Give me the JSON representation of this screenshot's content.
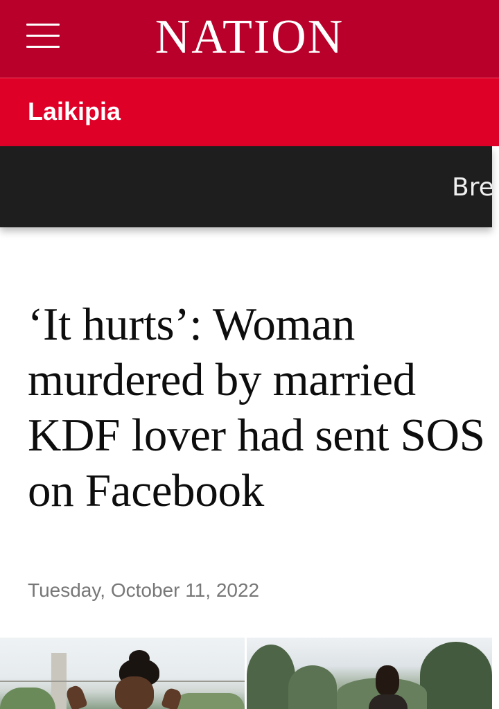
{
  "header": {
    "logo_text": "NATION",
    "menu_icon": "hamburger-menu-icon",
    "brand_color": "#b8002a"
  },
  "section": {
    "label": "Laikipia",
    "color": "#df0028"
  },
  "ticker": {
    "text": "Bre"
  },
  "article": {
    "headline": "‘It hurts’: Woman murdered by married KDF lover had sent SOS on Facebook",
    "date": "Tuesday, October 11, 2022"
  },
  "images": [
    {
      "name": "woman-photo"
    },
    {
      "name": "man-photo"
    }
  ]
}
